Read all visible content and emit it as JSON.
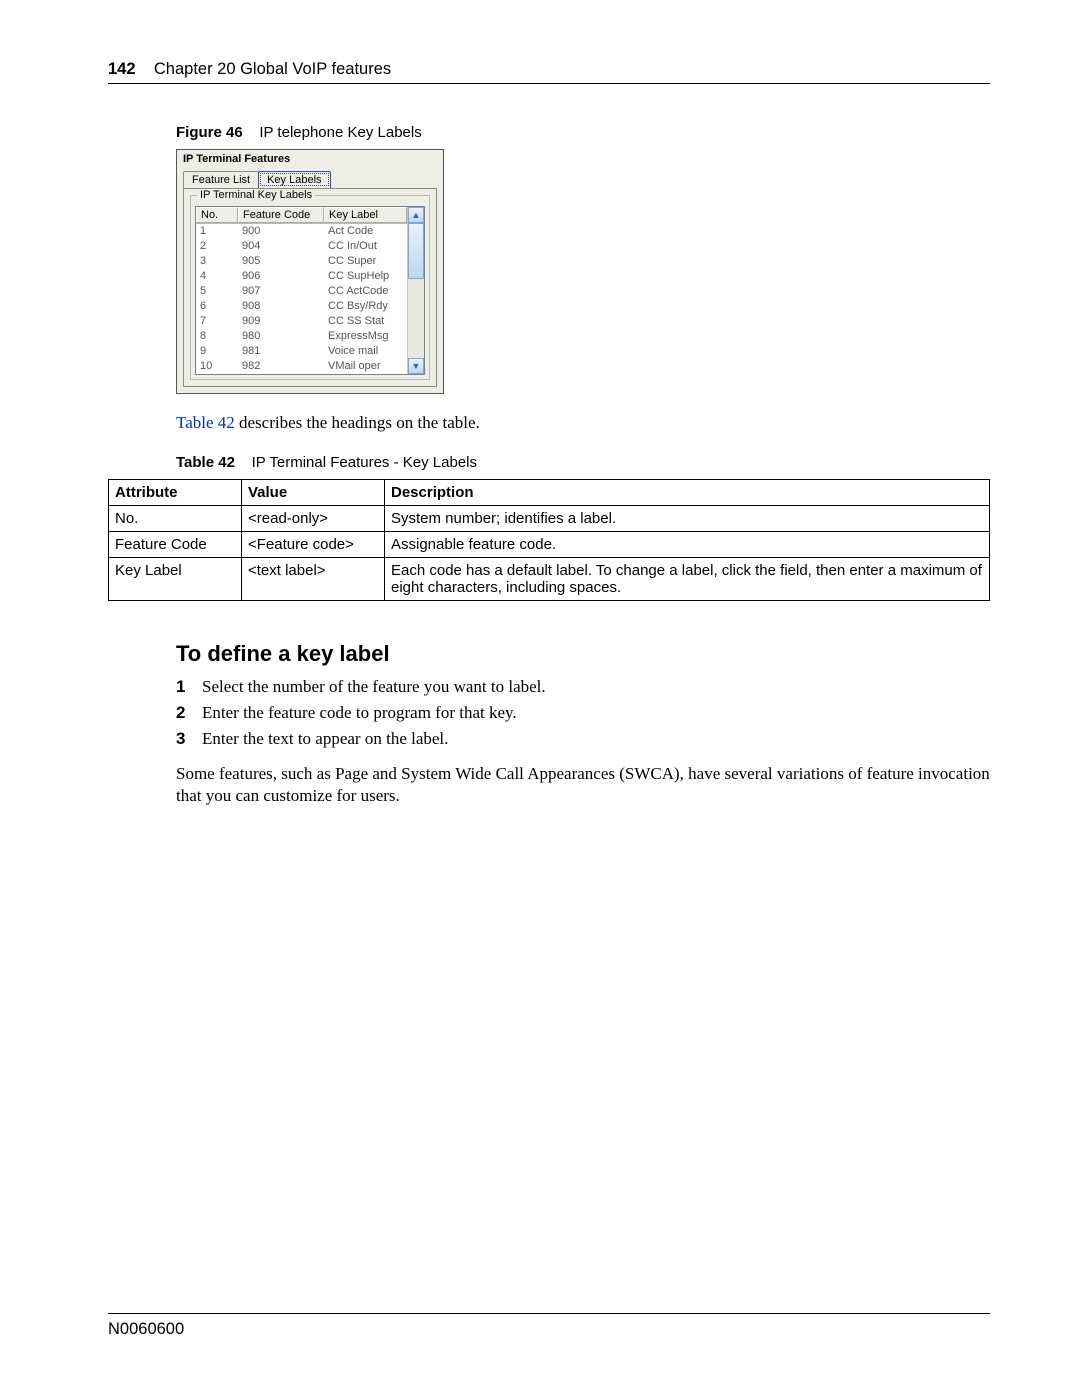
{
  "header": {
    "page_number": "142",
    "chapter": "Chapter 20  Global VoIP features"
  },
  "figure": {
    "label_prefix": "Figure 46",
    "label_text": "IP telephone Key Labels",
    "window_title": "IP Terminal Features",
    "tabs": {
      "feature_list": "Feature List",
      "key_labels": "Key Labels"
    },
    "fieldset_legend": "IP Terminal Key Labels",
    "columns": {
      "no": "No.",
      "feature_code": "Feature Code",
      "key_label": "Key Label"
    },
    "rows": [
      {
        "no": "1",
        "fc": "900",
        "kl": "Act Code"
      },
      {
        "no": "2",
        "fc": "904",
        "kl": "CC In/Out"
      },
      {
        "no": "3",
        "fc": "905",
        "kl": "CC Super"
      },
      {
        "no": "4",
        "fc": "906",
        "kl": "CC SupHelp"
      },
      {
        "no": "5",
        "fc": "907",
        "kl": "CC ActCode"
      },
      {
        "no": "6",
        "fc": "908",
        "kl": "CC Bsy/Rdy"
      },
      {
        "no": "7",
        "fc": "909",
        "kl": "CC SS Stat"
      },
      {
        "no": "8",
        "fc": "980",
        "kl": "ExpressMsg"
      },
      {
        "no": "9",
        "fc": "981",
        "kl": "Voice mail"
      },
      {
        "no": "10",
        "fc": "982",
        "kl": "VMail oper"
      }
    ]
  },
  "xref_sentence": {
    "link": "Table 42",
    "rest": " describes the headings on the table."
  },
  "table": {
    "label_prefix": "Table 42",
    "label_text": "IP Terminal Features - Key Labels",
    "headers": {
      "attr": "Attribute",
      "val": "Value",
      "desc": "Description"
    },
    "rows": [
      {
        "attr": "No.",
        "val": "<read-only>",
        "desc": "System number; identifies a label."
      },
      {
        "attr": "Feature Code",
        "val": "<Feature code>",
        "desc": "Assignable feature code."
      },
      {
        "attr": "Key Label",
        "val": "<text label>",
        "desc": "Each code has a default label. To change a label, click the field, then enter a maximum of eight characters, including spaces."
      }
    ]
  },
  "section_heading": "To define a key label",
  "steps": [
    "Select the number of the feature you want to label.",
    "Enter the feature code to program for that key.",
    "Enter the text to appear on the label."
  ],
  "closing_paragraph": "Some features, such as Page and System Wide Call Appearances (SWCA), have several variations of feature invocation that you can customize for users.",
  "footer": {
    "doc_id": "N0060600"
  }
}
